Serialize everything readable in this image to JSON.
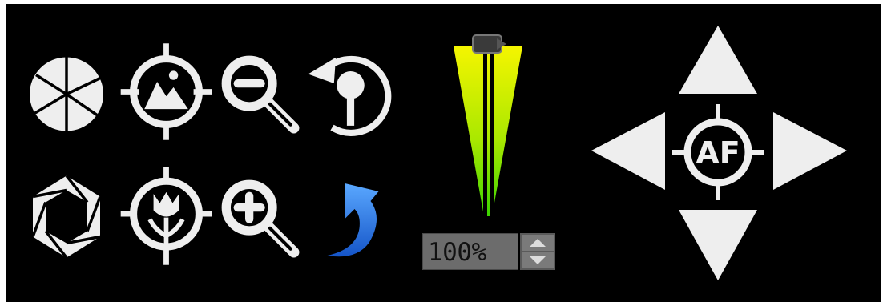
{
  "toolbar": {
    "zoom_value": "100%",
    "zoom_level": 1.0
  },
  "colors": {
    "background": "#000000",
    "icon": "#eeeeee",
    "accent_blue": "#2a7fe6",
    "gauge_top": "#f5f500",
    "gauge_bottom": "#3bd400"
  },
  "icons": [
    "aperture-open-icon",
    "landscape-focus-icon",
    "zoom-out-icon",
    "rotate-back-icon",
    "aperture-closed-icon",
    "macro-focus-icon",
    "zoom-in-icon",
    "undo-arrow-icon",
    "focus-gauge",
    "arrow-up-icon",
    "arrow-left-icon",
    "autofocus-icon",
    "arrow-right-icon",
    "arrow-down-icon"
  ]
}
